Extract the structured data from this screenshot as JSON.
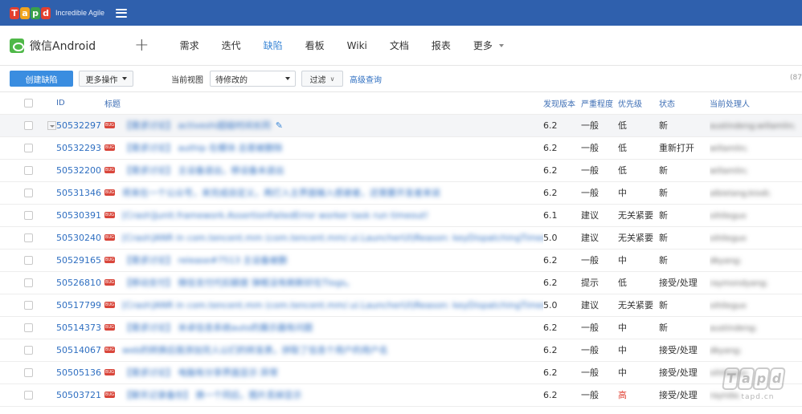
{
  "topbar": {
    "logo_letters": [
      "T",
      "a",
      "p",
      "d"
    ],
    "tagline": "Incredible Agile"
  },
  "project": {
    "name": "微信Android",
    "add_label": "+"
  },
  "nav": {
    "tabs": [
      "需求",
      "迭代",
      "缺陷",
      "看板",
      "Wiki",
      "文档",
      "报表",
      "更多"
    ],
    "active": "缺陷"
  },
  "toolbar": {
    "create_label": "创建缺陷",
    "more_ops_label": "更多操作",
    "view_label": "当前视图",
    "view_value": "待修改的",
    "filter_label": "过滤",
    "adv_query_label": "高级查询",
    "count": "(87"
  },
  "table": {
    "headers": {
      "id": "ID",
      "title": "标题",
      "version": "发现版本",
      "severity": "严重程度",
      "priority": "优先级",
      "status": "状态",
      "owner": "当前处理人"
    },
    "bug_badge": "BUG",
    "rows": [
      {
        "id": "50532297",
        "title": "【需求讨论】 activeshi超级时间长同",
        "version": "6.2",
        "severity": "一般",
        "priority": "低",
        "status": "新",
        "owner": "austindeng;willamlin;",
        "highlighted": true
      },
      {
        "id": "50532293",
        "title": "【需求讨论】 authip 在模块 总是被删除",
        "version": "6.2",
        "severity": "一般",
        "priority": "低",
        "status": "重新打开",
        "owner": "willamlin;"
      },
      {
        "id": "50532200",
        "title": "【需求讨论】 主设备退出，移设备未退出",
        "version": "6.2",
        "severity": "一般",
        "priority": "低",
        "status": "新",
        "owner": "willamlin;"
      },
      {
        "id": "50531346",
        "title": "将来在一个公众号，来完成自定义，再打入主界面输入感谢者，还需要开发者来说",
        "version": "6.2",
        "severity": "一般",
        "priority": "中",
        "status": "新",
        "owner": "albielang;kiodi;"
      },
      {
        "id": "50530391",
        "title": "[Crash]junit.framework.AssertionFailedError worker task run timeout!",
        "version": "6.1",
        "severity": "建议",
        "priority": "无关紧要",
        "status": "新",
        "owner": "oihlleguo"
      },
      {
        "id": "50530240",
        "title": "[Crash]ANR in com.tencent.mm (com.tencent.mm/.ui.LauncherUI)Reason: keyDispatchingTimed ...",
        "version": "5.0",
        "severity": "建议",
        "priority": "无关紧要",
        "status": "新",
        "owner": "oihlleguo"
      },
      {
        "id": "50529165",
        "title": "【需求讨论】 release#7513 主设备被删",
        "version": "6.2",
        "severity": "一般",
        "priority": "中",
        "status": "新",
        "owner": "dkyang;"
      },
      {
        "id": "50526810",
        "title": "【移动支付】 微信支付代扣额度 弹框没有刷新好在Tlogs。",
        "version": "6.2",
        "severity": "提示",
        "priority": "低",
        "status": "接受/处理",
        "owner": "raymondyang;"
      },
      {
        "id": "50517799",
        "title": "[Crash]ANR in com.tencent.mm (com.tencent.mm/.ui.LauncherUI)Reason: keyDispatchingTimed ...",
        "version": "5.0",
        "severity": "建议",
        "priority": "无关紧要",
        "status": "新",
        "owner": "oihlleguo"
      },
      {
        "id": "50514373",
        "title": "【需求讨论】 米卓信息系统auto的展示器有问题",
        "version": "6.2",
        "severity": "一般",
        "priority": "中",
        "status": "新",
        "owner": "austindeng;"
      },
      {
        "id": "50514067",
        "title": "web的转换后我添加完人以们的转发表，拼取了信息个用户的用户名",
        "version": "6.2",
        "severity": "一般",
        "priority": "中",
        "status": "接受/处理",
        "owner": "dkyang;"
      },
      {
        "id": "50505136",
        "title": "【需求讨论】 电脑有分享界面显示 异常",
        "version": "6.2",
        "severity": "一般",
        "priority": "中",
        "status": "接受/处理",
        "owner": "oihlleguo;"
      },
      {
        "id": "50503721",
        "title": "【聊天记录备份】 换一个同后，图片丢掉显示",
        "version": "6.2",
        "severity": "一般",
        "priority": "高",
        "status": "接受/处理",
        "owner": "raynda;"
      }
    ]
  },
  "watermark": {
    "letters": [
      "T",
      "a",
      "p",
      "d"
    ],
    "url": "tapd.cn"
  },
  "colors": {
    "topbar": "#2f60ad",
    "accent": "#3a8de0",
    "link": "#2f6fc1",
    "bug_badge": "#d9463b",
    "priority_high": "#e2473a"
  }
}
